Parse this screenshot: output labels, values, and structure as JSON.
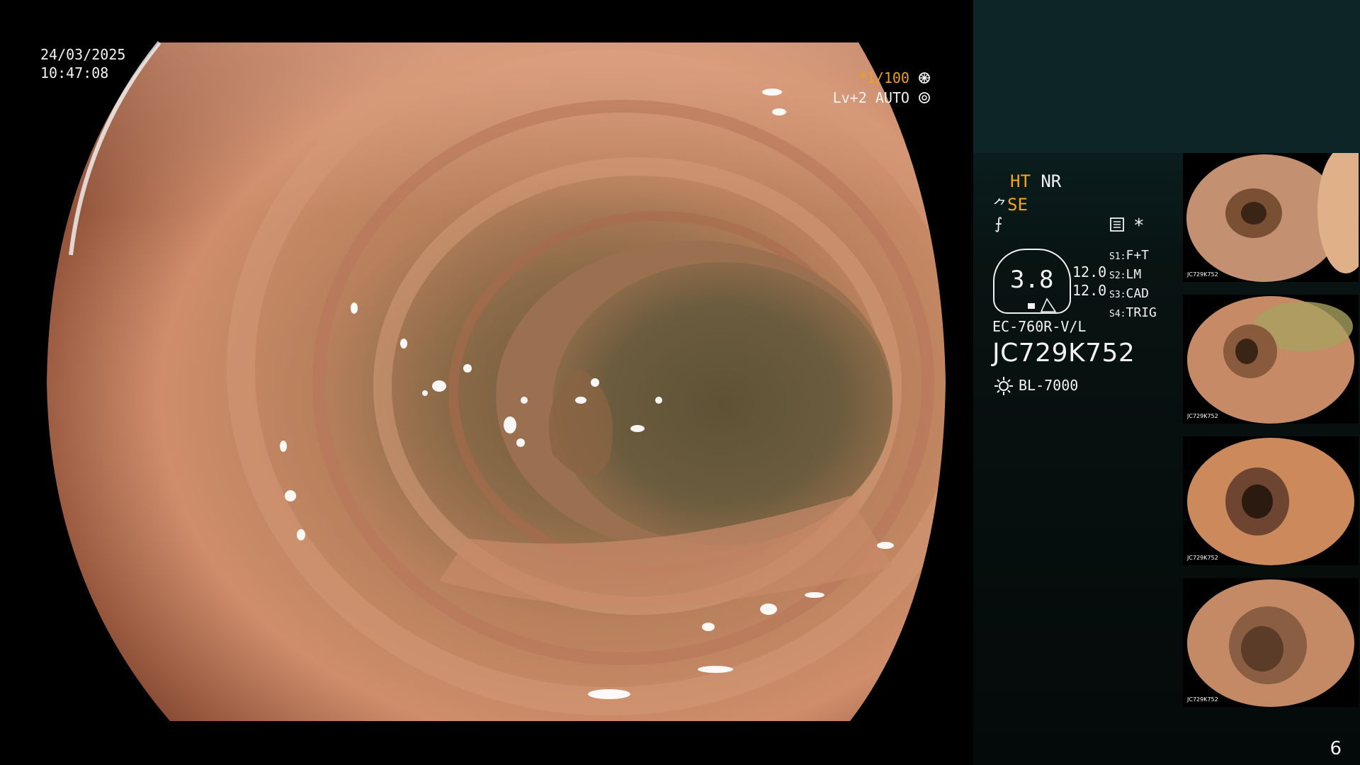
{
  "overlay": {
    "date": "24/03/2025",
    "time": "10:47:08",
    "shutter": "*1/100",
    "level": "Lv+2 AUTO"
  },
  "side_panel": {
    "ht": "HT",
    "nr": "NR",
    "se": "SE",
    "star": "*",
    "scope_value": "3.8",
    "num_top": "12.0",
    "num_bottom": "12.0",
    "s_labels": [
      "S1",
      "S2",
      "S3",
      "S4"
    ],
    "s_values": [
      "F+T",
      "LM",
      "CAD",
      "TRIG"
    ],
    "model": "EC-760R-V/L",
    "serial": "JC729K752",
    "light_source": "BL-7000",
    "page_number": "6"
  },
  "thumbnails": [
    {
      "serial": "JC729K752"
    },
    {
      "serial": "JC729K752"
    },
    {
      "serial": "JC729K752"
    },
    {
      "serial": "JC729K752"
    }
  ],
  "colors": {
    "accent_orange": "#f3a623",
    "panel_bg": "#0e2527",
    "tissue": "#c9805a"
  }
}
